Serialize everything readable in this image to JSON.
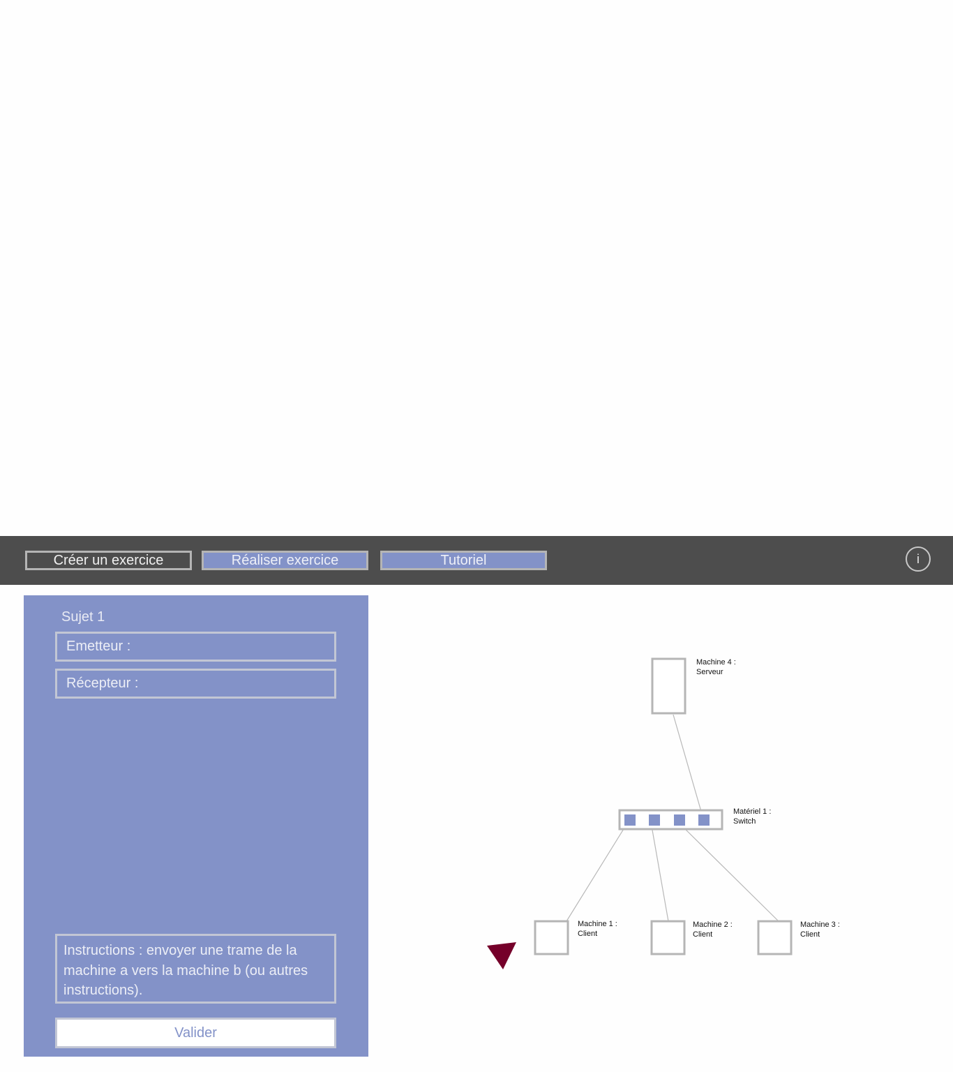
{
  "toolbar": {
    "create_label": "Créer un exercice",
    "realize_label": "Réaliser exercice",
    "tutorial_label": "Tutoriel",
    "info_label": "i"
  },
  "panel": {
    "title": "Sujet 1",
    "emitter_label": "Emetteur :",
    "receiver_label": "Récepteur :",
    "instructions": "Instructions : envoyer une trame de la machine a vers la machine b (ou autres instructions).",
    "validate_label": "Valider"
  },
  "diagram": {
    "machine4": {
      "name": "Machine 4 :",
      "role": "Serveur"
    },
    "switch": {
      "name": "Matériel 1 :",
      "role": "Switch"
    },
    "machine1": {
      "name": "Machine 1 :",
      "role": "Client"
    },
    "machine2": {
      "name": "Machine 2 :",
      "role": "Client"
    },
    "machine3": {
      "name": "Machine 3 :",
      "role": "Client"
    }
  },
  "colors": {
    "toolbar_bg": "#4d4d4d",
    "accent": "#8392c8",
    "border_gray": "#b5b5b5",
    "cursor_marker": "#75002a"
  }
}
